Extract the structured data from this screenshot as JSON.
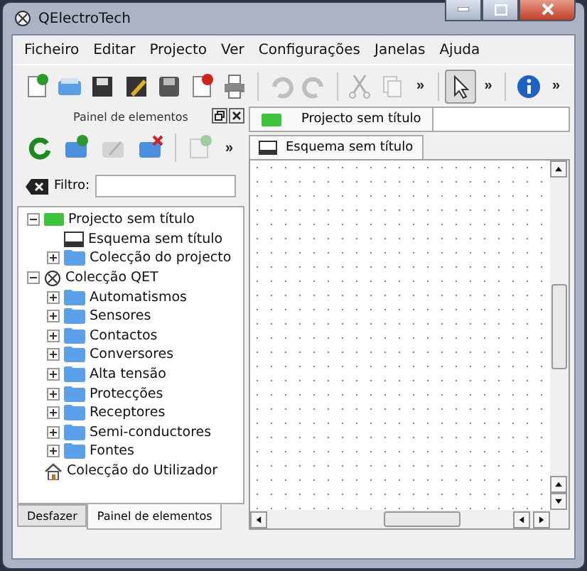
{
  "window": {
    "title": "QElectroTech"
  },
  "menu": [
    "Ficheiro",
    "Editar",
    "Projecto",
    "Ver",
    "Configurações",
    "Janelas",
    "Ajuda"
  ],
  "toolbar": [
    {
      "kind": "new",
      "disabled": false
    },
    {
      "kind": "open",
      "disabled": false
    },
    {
      "kind": "save",
      "disabled": false
    },
    {
      "kind": "saveas",
      "disabled": false
    },
    {
      "kind": "saveall",
      "disabled": false
    },
    {
      "kind": "close",
      "disabled": false
    },
    {
      "kind": "print",
      "disabled": false
    },
    {
      "kind": "sep"
    },
    {
      "kind": "undo",
      "disabled": true
    },
    {
      "kind": "redo",
      "disabled": true
    },
    {
      "kind": "sep"
    },
    {
      "kind": "cut",
      "disabled": true
    },
    {
      "kind": "copy",
      "disabled": true
    },
    {
      "kind": "more",
      "label": "»"
    },
    {
      "kind": "sep"
    },
    {
      "kind": "pointer",
      "selected": true
    },
    {
      "kind": "more",
      "label": "»"
    },
    {
      "kind": "sep"
    },
    {
      "kind": "info",
      "disabled": false
    },
    {
      "kind": "more",
      "label": "»"
    }
  ],
  "panel": {
    "title": "Painel de elementos",
    "toolbar": [
      {
        "kind": "reload",
        "disabled": false
      },
      {
        "kind": "newfolder",
        "disabled": false
      },
      {
        "kind": "edit",
        "disabled": true
      },
      {
        "kind": "delfolder",
        "disabled": false
      },
      {
        "kind": "sep"
      },
      {
        "kind": "newelement",
        "disabled": true
      },
      {
        "kind": "more",
        "label": "»"
      }
    ],
    "filter": {
      "label": "Filtro:"
    },
    "tree": [
      {
        "kind": "project",
        "label": "Projecto sem título",
        "expanded": true,
        "children": [
          {
            "kind": "diagram",
            "label": "Esquema sem título"
          },
          {
            "kind": "folder",
            "label": "Colecção do projecto",
            "expanded": false
          }
        ]
      },
      {
        "kind": "collection",
        "label": "Colecção QET",
        "expanded": true,
        "children": [
          {
            "kind": "folder",
            "label": "Automatismos",
            "expanded": false
          },
          {
            "kind": "folder",
            "label": "Sensores",
            "expanded": false
          },
          {
            "kind": "folder",
            "label": "Contactos",
            "expanded": false
          },
          {
            "kind": "folder",
            "label": "Conversores",
            "expanded": false
          },
          {
            "kind": "folder",
            "label": "Alta tensão",
            "expanded": false
          },
          {
            "kind": "folder",
            "label": "Protecções",
            "expanded": false
          },
          {
            "kind": "folder",
            "label": "Receptores",
            "expanded": false
          },
          {
            "kind": "folder",
            "label": "Semi-conductores",
            "expanded": false
          },
          {
            "kind": "folder",
            "label": "Fontes",
            "expanded": false
          }
        ]
      },
      {
        "kind": "home",
        "label": "Colecção do Utilizador"
      }
    ]
  },
  "bottom_tabs": [
    {
      "label": "Desfazer",
      "selected": false
    },
    {
      "label": "Painel de elementos",
      "selected": true
    }
  ],
  "project_tabs": [
    {
      "label": "Projecto sem título",
      "selected": true
    }
  ],
  "diagram_tabs": [
    {
      "label": "Esquema sem título",
      "selected": true
    }
  ]
}
